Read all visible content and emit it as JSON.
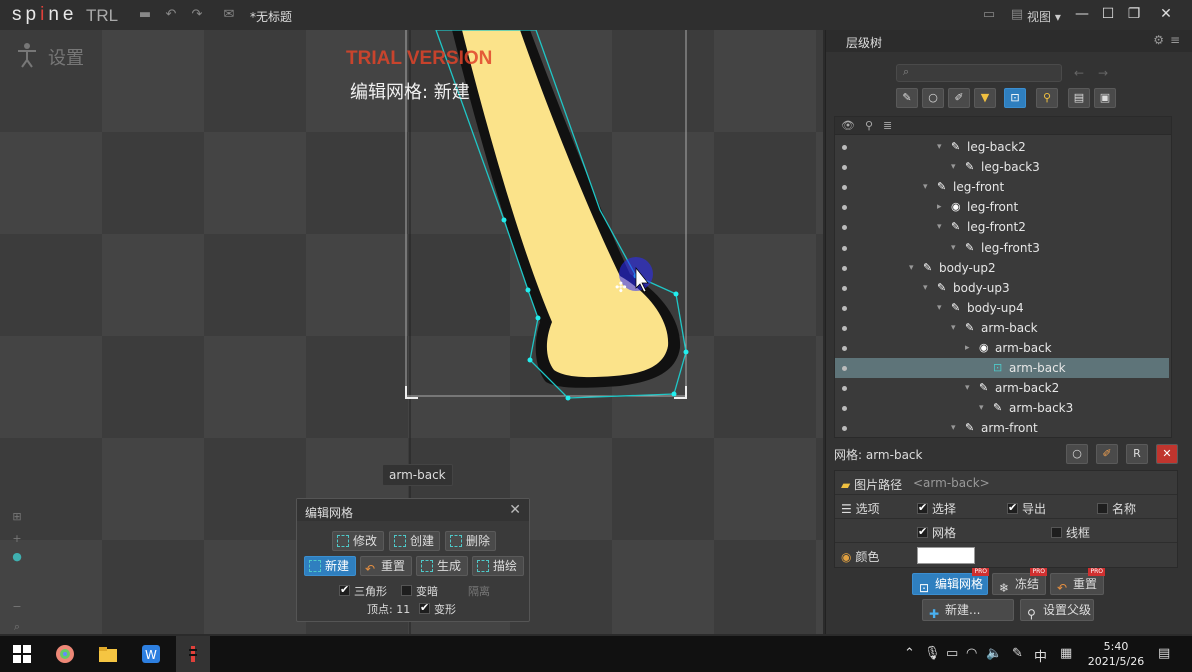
{
  "titlebar": {
    "logo_main": "spine",
    "logo_suffix": "TRL",
    "doc_title": "*无标题",
    "view_menu": "视图"
  },
  "viewport": {
    "settings_label": "设置",
    "trial_text": "TRIAL VERSION",
    "mode_text": "编辑网格: 新建",
    "bone_tag": "arm-back"
  },
  "mesh_panel": {
    "title": "编辑网格",
    "buttons_row1": [
      "修改",
      "创建",
      "删除"
    ],
    "buttons_row2": [
      "新建",
      "重置",
      "生成",
      "描绘"
    ],
    "triangles_label": "三角形",
    "dim_label": "变暗",
    "isolate_label": "隔离",
    "vertices_label": "顶点: 11",
    "deform_label": "变形"
  },
  "right_panel": {
    "title": "层级树",
    "search_placeholder": "",
    "tree": [
      {
        "label": "leg-back2",
        "indent": 1,
        "icon": "bone"
      },
      {
        "label": "leg-back3",
        "indent": 2,
        "icon": "bone"
      },
      {
        "label": "leg-front",
        "indent": 0,
        "icon": "bone"
      },
      {
        "label": "leg-front",
        "indent": 1,
        "icon": "slot"
      },
      {
        "label": "leg-front2",
        "indent": 1,
        "icon": "bone"
      },
      {
        "label": "leg-front3",
        "indent": 2,
        "icon": "bone"
      },
      {
        "label": "body-up2",
        "indent": -1,
        "icon": "bone"
      },
      {
        "label": "body-up3",
        "indent": 0,
        "icon": "bone"
      },
      {
        "label": "body-up4",
        "indent": 1,
        "icon": "bone"
      },
      {
        "label": "arm-back",
        "indent": 2,
        "icon": "bone"
      },
      {
        "label": "arm-back",
        "indent": 3,
        "icon": "slot"
      },
      {
        "label": "arm-back",
        "indent": 4,
        "icon": "mesh",
        "selected": true
      },
      {
        "label": "arm-back2",
        "indent": 3,
        "icon": "bone"
      },
      {
        "label": "arm-back3",
        "indent": 4,
        "icon": "bone"
      },
      {
        "label": "arm-front",
        "indent": 2,
        "icon": "bone"
      }
    ],
    "mesh_name": "网格: arm-back",
    "props": {
      "image_path_label": "图片路径",
      "image_path_value": "<arm-back>",
      "options_label": "选项",
      "select_label": "选择",
      "export_label": "导出",
      "name_label": "名称",
      "mesh_label": "网格",
      "wireframe_label": "线框",
      "color_label": "颜色",
      "color_value": "#ffffff"
    },
    "buttons": {
      "edit_mesh": "编辑网格",
      "freeze": "冻结",
      "reset": "重置",
      "new": "新建...",
      "set_parent": "设置父级"
    }
  },
  "taskbar": {
    "time": "5:40",
    "date": "2021/5/26",
    "ime": "中"
  }
}
